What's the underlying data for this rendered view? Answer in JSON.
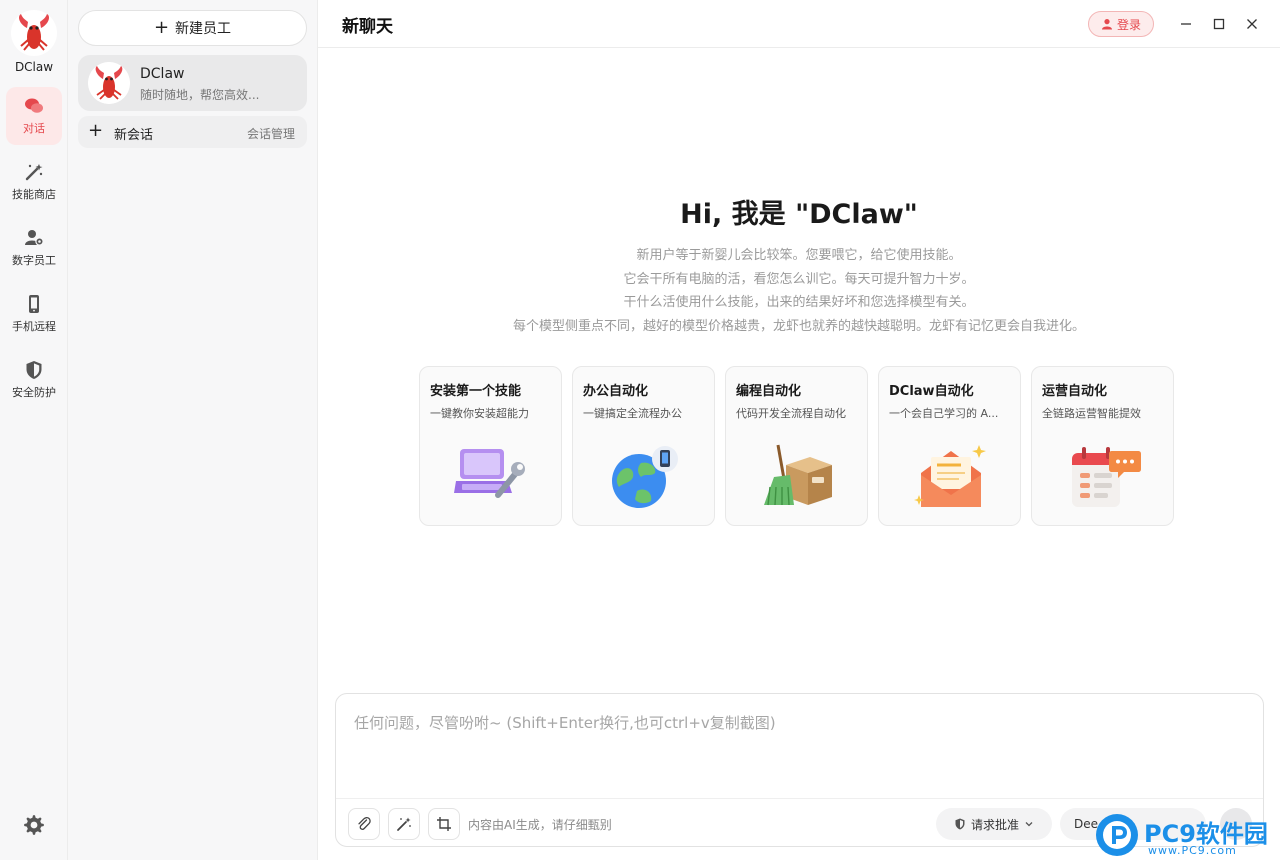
{
  "app": {
    "name": "DClaw",
    "brand_color": "#e5484d"
  },
  "rail": {
    "items": [
      {
        "label": "对话",
        "icon": "chat-bubbles-icon",
        "active": true
      },
      {
        "label": "技能商店",
        "icon": "magic-wand-icon",
        "active": false
      },
      {
        "label": "数字员工",
        "icon": "user-gear-icon",
        "active": false
      },
      {
        "label": "手机远程",
        "icon": "phone-icon",
        "active": false
      },
      {
        "label": "安全防护",
        "icon": "shield-icon",
        "active": false
      }
    ],
    "settings_icon": "gear-icon"
  },
  "sidebar": {
    "new_employee_label": "新建员工",
    "employee": {
      "name": "DClaw",
      "desc": "随时随地，帮您高效..."
    },
    "new_session_label": "新会话",
    "session_manage_label": "会话管理"
  },
  "header": {
    "title": "新聊天",
    "login_label": "登录"
  },
  "hero": {
    "title": "Hi, 我是 \"DClaw\"",
    "lines": [
      "新用户等于新婴儿会比较笨。您要喂它，给它使用技能。",
      "它会干所有电脑的活，看您怎么训它。每天可提升智力十岁。",
      "干什么活使用什么技能，出来的结果好坏和您选择模型有关。",
      "每个模型侧重点不同，越好的模型价格越贵，龙虾也就养的越快越聪明。龙虾有记忆更会自我进化。"
    ]
  },
  "cards": [
    {
      "title": "安装第一个技能",
      "subtitle": "一键教你安装超能力",
      "icon": "laptop-wrench-icon"
    },
    {
      "title": "办公自动化",
      "subtitle": "一键搞定全流程办公",
      "icon": "globe-phone-icon"
    },
    {
      "title": "编程自动化",
      "subtitle": "代码开发全流程自动化",
      "icon": "broom-box-icon"
    },
    {
      "title": "DClaw自动化",
      "subtitle": "一个会自己学习的 A...",
      "icon": "envelope-letter-icon"
    },
    {
      "title": "运营自动化",
      "subtitle": "全链路运营智能提效",
      "icon": "calendar-chat-icon"
    }
  ],
  "composer": {
    "placeholder": "任何问题，尽管吩咐~ (Shift+Enter换行,也可ctrl+v复制截图)",
    "disclaimer": "内容由AI生成，请仔细甄别",
    "approve_label": "请求批准",
    "model_label": "Dee"
  },
  "watermark": {
    "name": "PC9软件园",
    "url": "www.PC9.com"
  }
}
